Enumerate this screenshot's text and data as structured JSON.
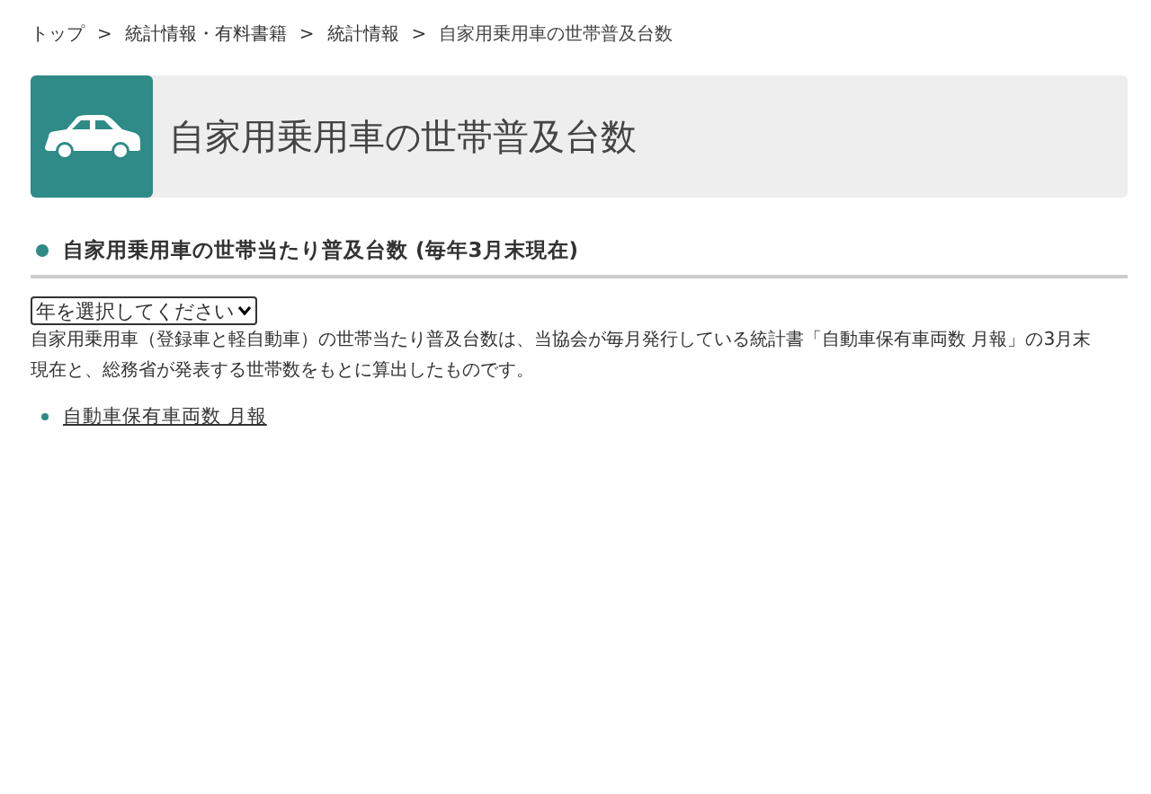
{
  "breadcrumb": {
    "separator": ">",
    "items": [
      {
        "label": "トップ"
      },
      {
        "label": "統計情報・有料書籍"
      },
      {
        "label": "統計情報"
      },
      {
        "label": "自家用乗用車の世帯普及台数"
      }
    ]
  },
  "page_title": "自家用乗用車の世帯普及台数",
  "section": {
    "heading": "自家用乗用車の世帯当たり普及台数 (毎年3月末現在)",
    "year_select": {
      "value": "年を選択してください"
    },
    "description": "自家用乗用車（登録車と軽自動車）の世帯当たり普及台数は、当協会が毎月発行している統計書「自動車保有車両数 月報」の3月末現在と、総務省が発表する世帯数をもとに算出したものです。",
    "links": [
      "自動車保有車両数 月報"
    ]
  }
}
